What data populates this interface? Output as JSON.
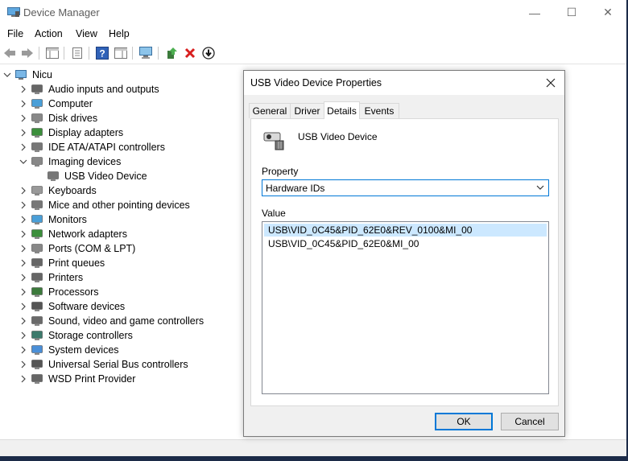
{
  "window": {
    "title": "Device Manager",
    "minimize": "—",
    "maximize": "☐",
    "close": "✕"
  },
  "menu": [
    "File",
    "Action",
    "View",
    "Help"
  ],
  "toolbar_icons": [
    "back-icon",
    "forward-icon",
    "show-hide-tree-icon",
    "properties-icon",
    "help-icon",
    "action-view-icon",
    "scan-hardware-icon",
    "update-driver-icon",
    "uninstall-icon",
    "disable-device-icon"
  ],
  "tree": {
    "root": "Nicu",
    "categories": [
      {
        "label": "Audio inputs and outputs",
        "icon": "speaker-icon"
      },
      {
        "label": "Computer",
        "icon": "computer-icon"
      },
      {
        "label": "Disk drives",
        "icon": "disk-icon"
      },
      {
        "label": "Display adapters",
        "icon": "display-adapter-icon"
      },
      {
        "label": "IDE ATA/ATAPI controllers",
        "icon": "ide-controller-icon"
      },
      {
        "label": "Imaging devices",
        "icon": "camera-icon",
        "expanded": true,
        "children": [
          {
            "label": "USB Video Device",
            "icon": "webcam-icon"
          }
        ]
      },
      {
        "label": "Keyboards",
        "icon": "keyboard-icon"
      },
      {
        "label": "Mice and other pointing devices",
        "icon": "mouse-icon"
      },
      {
        "label": "Monitors",
        "icon": "monitor-icon"
      },
      {
        "label": "Network adapters",
        "icon": "network-icon"
      },
      {
        "label": "Ports (COM & LPT)",
        "icon": "port-icon"
      },
      {
        "label": "Print queues",
        "icon": "printer-icon"
      },
      {
        "label": "Printers",
        "icon": "printer-icon"
      },
      {
        "label": "Processors",
        "icon": "processor-icon"
      },
      {
        "label": "Software devices",
        "icon": "software-device-icon"
      },
      {
        "label": "Sound, video and game controllers",
        "icon": "sound-icon"
      },
      {
        "label": "Storage controllers",
        "icon": "storage-icon"
      },
      {
        "label": "System devices",
        "icon": "system-device-icon"
      },
      {
        "label": "Universal Serial Bus controllers",
        "icon": "usb-icon"
      },
      {
        "label": "WSD Print Provider",
        "icon": "wsd-icon"
      }
    ]
  },
  "dialog": {
    "title": "USB Video Device Properties",
    "tabs": [
      "General",
      "Driver",
      "Details",
      "Events"
    ],
    "active_tab": "Details",
    "device_name": "USB Video Device",
    "property_label": "Property",
    "property_value": "Hardware IDs",
    "value_label": "Value",
    "values": [
      "USB\\VID_0C45&PID_62E0&REV_0100&MI_00",
      "USB\\VID_0C45&PID_62E0&MI_00"
    ],
    "selected_value_index": 0,
    "ok": "OK",
    "cancel": "Cancel"
  }
}
